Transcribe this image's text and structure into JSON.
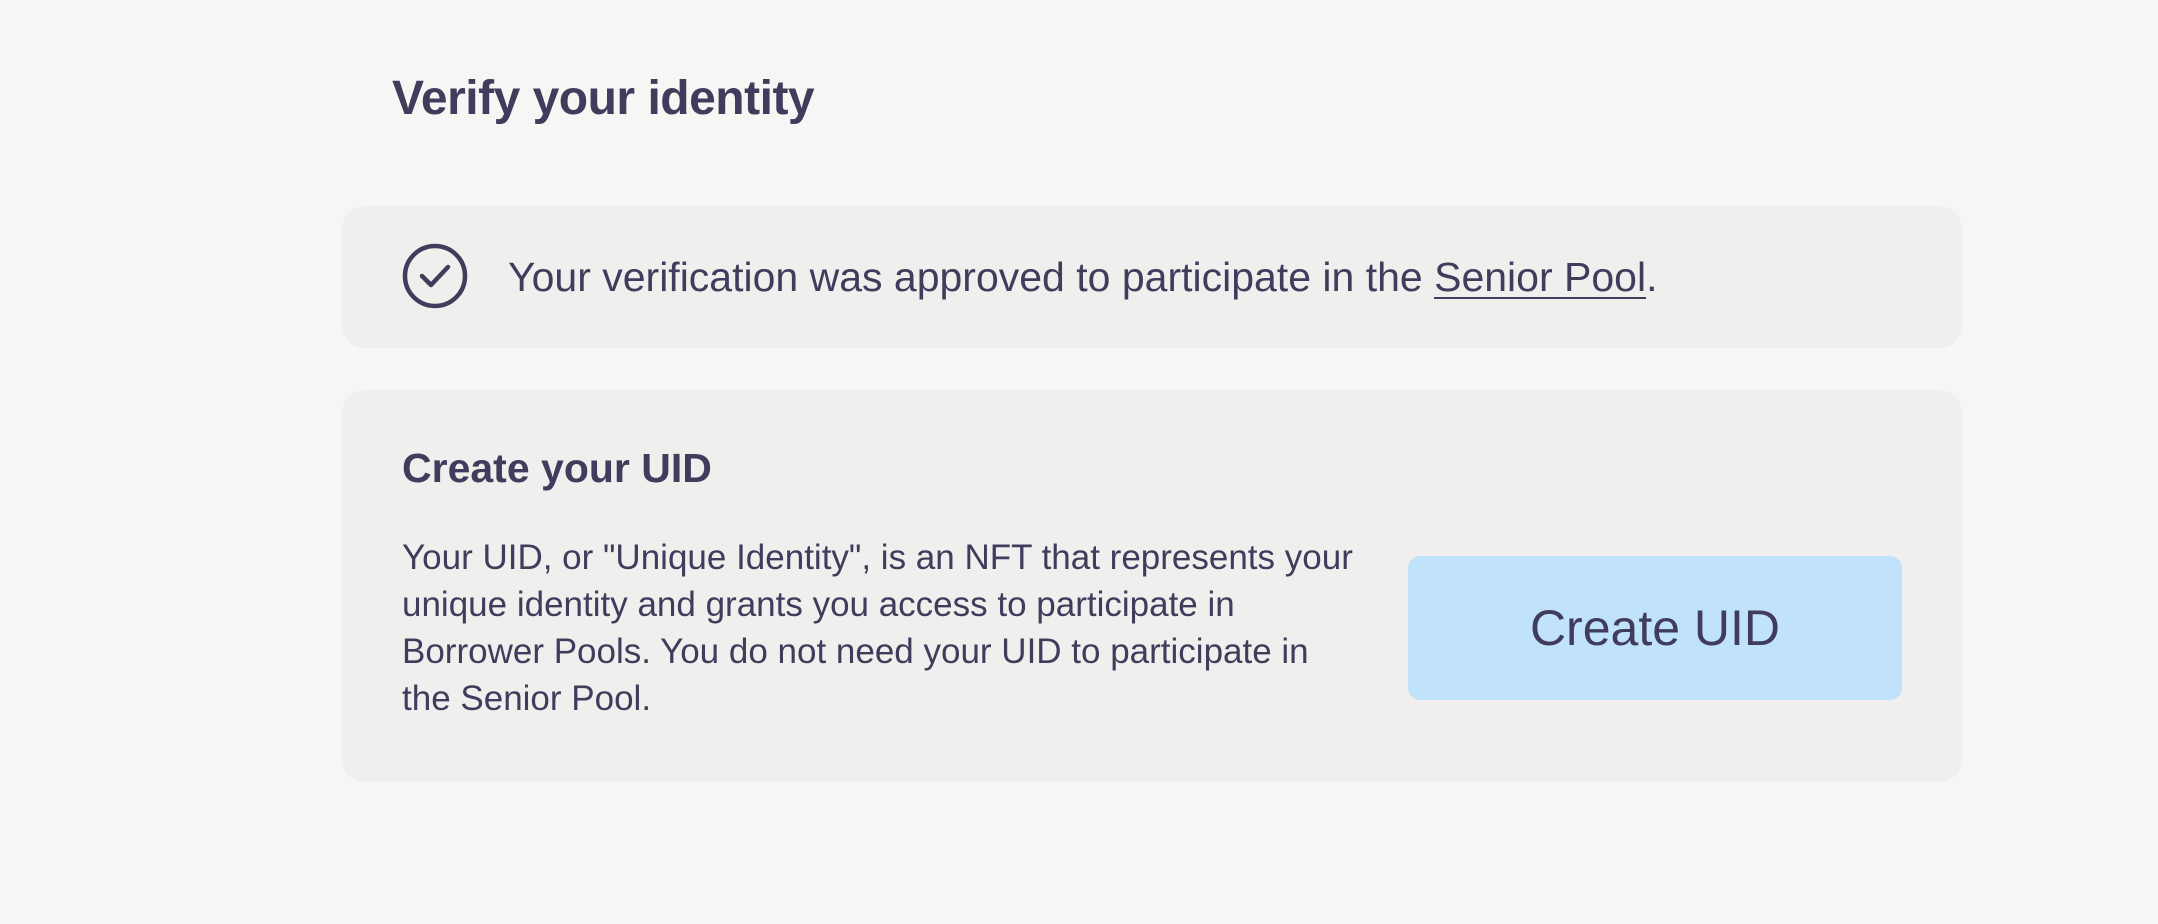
{
  "page": {
    "title": "Verify your identity"
  },
  "approval": {
    "icon": "check-circle-icon",
    "text_before": "Your verification was approved to participate in the ",
    "link_label": "Senior Pool",
    "text_after": "."
  },
  "uid": {
    "title": "Create your UID",
    "description": "Your UID, or \"Unique Identity\", is an NFT that represents your unique identity and grants you access to participate in Borrower Pools. You do not need your UID to participate in the Senior Pool.",
    "button_label": "Create UID"
  },
  "colors": {
    "background": "#f7f6f4",
    "card": "#f0efed",
    "text": "#403c5c",
    "button": "#c0e2fa"
  }
}
